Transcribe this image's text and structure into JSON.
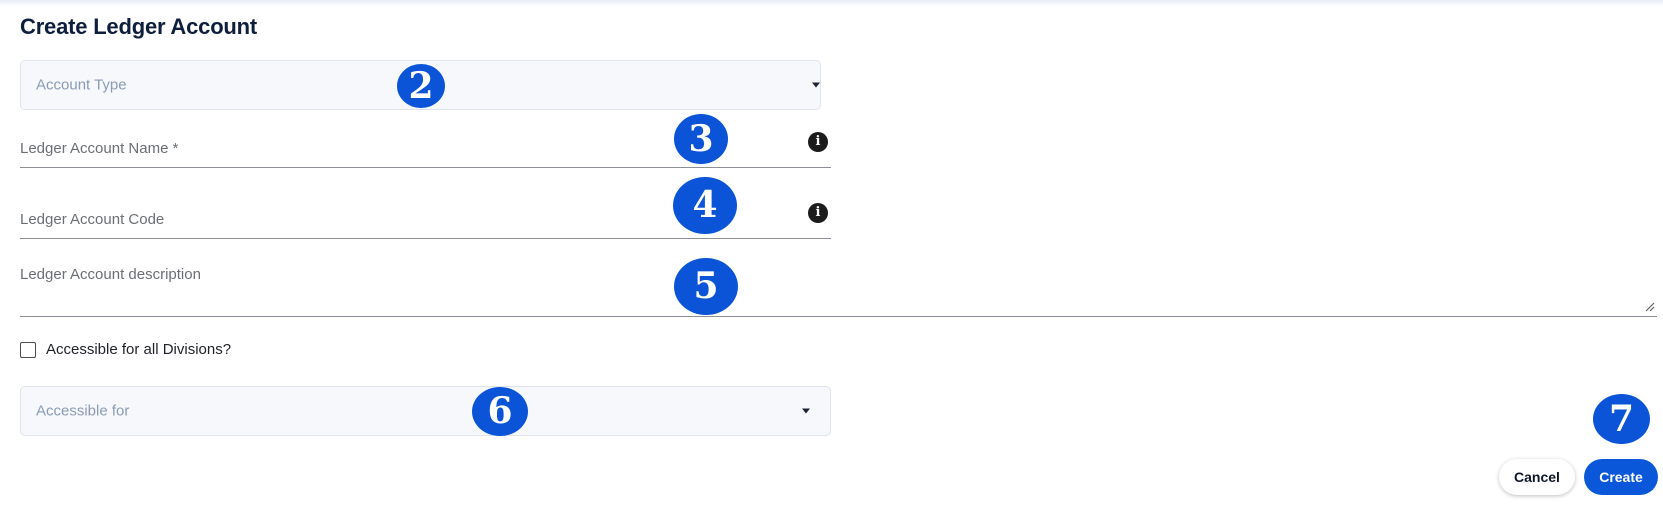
{
  "page": {
    "title": "Create Ledger Account"
  },
  "form": {
    "account_type": {
      "placeholder": "Account Type",
      "value": ""
    },
    "ledger_account_name": {
      "label": "Ledger Account Name *",
      "value": ""
    },
    "ledger_account_code": {
      "label": "Ledger Account Code",
      "value": ""
    },
    "ledger_account_description": {
      "label": "Ledger Account description",
      "value": ""
    },
    "accessible_all_divisions": {
      "label": "Accessible for all Divisions?",
      "checked": false
    },
    "accessible_for": {
      "placeholder": "Accessible for",
      "value": ""
    }
  },
  "icons": {
    "info": "info-icon",
    "info_glyph": "i",
    "dropdown": "caret-down-icon"
  },
  "actions": {
    "cancel_label": "Cancel",
    "create_label": "Create"
  },
  "step_markers": [
    "2",
    "3",
    "4",
    "5",
    "6",
    "7"
  ],
  "colors": {
    "accent": "#0a57d9",
    "marker": "#0b54d8",
    "title": "#0e1e3d",
    "placeholder": "#8a9bb8"
  }
}
